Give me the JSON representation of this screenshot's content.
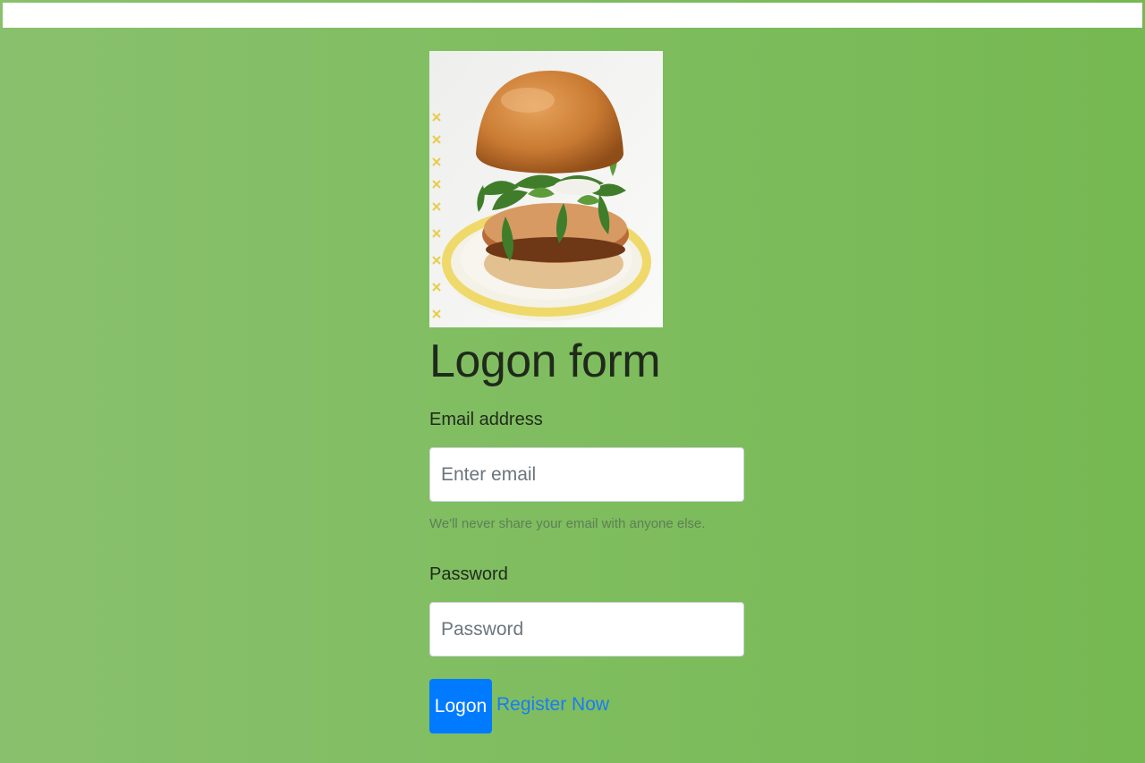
{
  "form": {
    "title": "Logon form",
    "email_label": "Email address",
    "email_placeholder": "Enter email",
    "email_value": "",
    "email_help": "We'll never share your email with anyone else.",
    "password_label": "Password",
    "password_placeholder": "Password",
    "password_value": "",
    "submit_label": "Logon",
    "register_link": "Register Now"
  },
  "colors": {
    "background": "#7fbd5f",
    "button": "#007bff",
    "link": "#1a7cf4"
  },
  "image": {
    "alt": "burger-photo"
  }
}
